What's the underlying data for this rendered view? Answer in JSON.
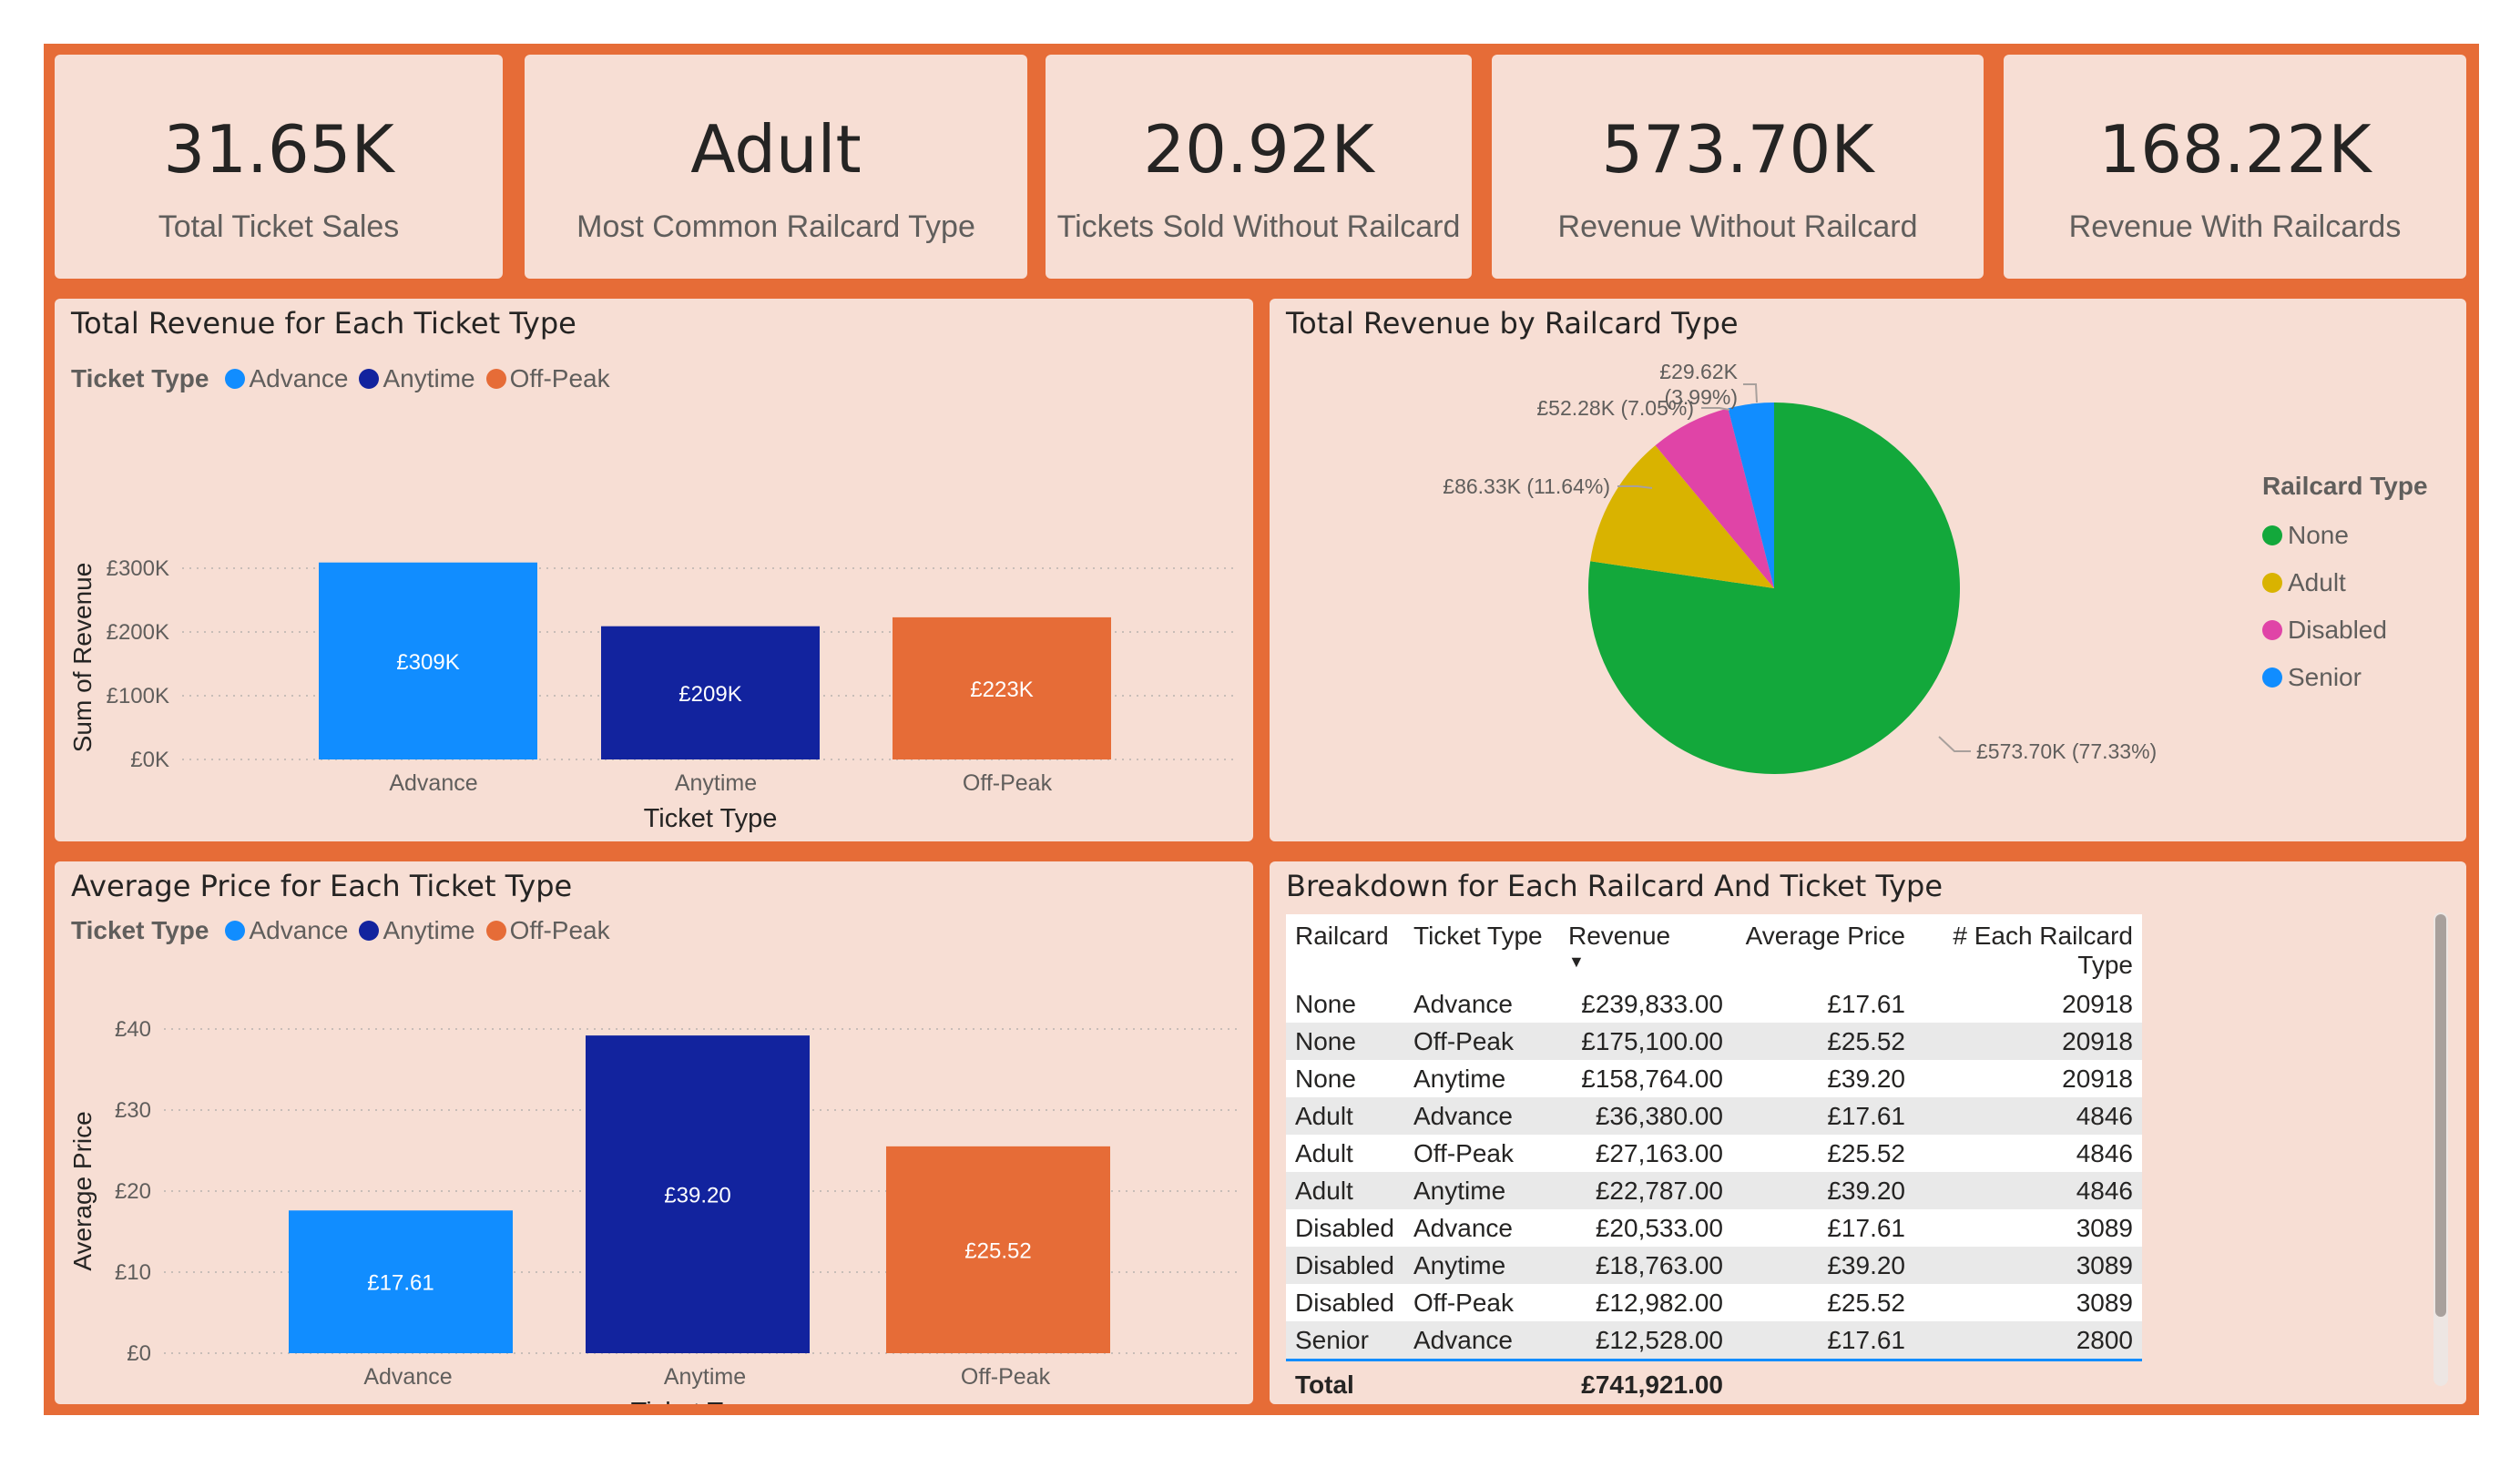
{
  "kpis": [
    {
      "value": "31.65K",
      "label": "Total Ticket Sales"
    },
    {
      "value": "Adult",
      "label": "Most Common Railcard Type"
    },
    {
      "value": "20.92K",
      "label": "Tickets Sold Without Railcard"
    },
    {
      "value": "573.70K",
      "label": "Revenue Without Railcard"
    },
    {
      "value": "168.22K",
      "label": "Revenue With Railcards"
    }
  ],
  "colors": {
    "frame": "#E66C37",
    "panel": "#F7DED4",
    "advance": "#118DFF",
    "anytime": "#12239E",
    "offpeak": "#E66C37",
    "none": "#13A83B",
    "adult": "#D9B300",
    "disabled": "#E044A7",
    "senior": "#118DFF"
  },
  "revenue_chart": {
    "title": "Total Revenue for Each Ticket Type",
    "legend_title": "Ticket Type",
    "legend": [
      "Advance",
      "Anytime",
      "Off-Peak"
    ],
    "chart_data": {
      "type": "bar",
      "categories": [
        "Advance",
        "Anytime",
        "Off-Peak"
      ],
      "values": [
        309,
        209,
        223
      ],
      "data_labels": [
        "£309K",
        "£209K",
        "£223K"
      ],
      "yticks": [
        "£0K",
        "£100K",
        "£200K",
        "£300K"
      ],
      "ylim": [
        0,
        320
      ],
      "xlabel": "Ticket Type",
      "ylabel": "Sum of Revenue",
      "grid": true
    }
  },
  "price_chart": {
    "title": "Average Price for Each Ticket Type",
    "legend_title": "Ticket Type",
    "legend": [
      "Advance",
      "Anytime",
      "Off-Peak"
    ],
    "chart_data": {
      "type": "bar",
      "categories": [
        "Advance",
        "Anytime",
        "Off-Peak"
      ],
      "values": [
        17.61,
        39.2,
        25.52
      ],
      "data_labels": [
        "£17.61",
        "£39.20",
        "£25.52"
      ],
      "yticks": [
        "£0",
        "£10",
        "£20",
        "£30",
        "£40"
      ],
      "ylim": [
        0,
        40
      ],
      "xlabel": "Ticket Type",
      "ylabel": "Average Price",
      "grid": true
    }
  },
  "pie_chart": {
    "title": "Total Revenue by Railcard Type",
    "legend_title": "Railcard Type",
    "legend": [
      "None",
      "Adult",
      "Disabled",
      "Senior"
    ],
    "chart_data": {
      "type": "pie",
      "categories": [
        "None",
        "Adult",
        "Disabled",
        "Senior"
      ],
      "values": [
        573.7,
        86.33,
        52.28,
        29.62
      ],
      "percents": [
        77.33,
        11.64,
        7.05,
        3.99
      ],
      "data_labels": [
        "£573.70K (77.33%)",
        "£86.33K (11.64%)",
        "£52.28K (7.05%)",
        "£29.62K",
        "(3.99%)"
      ]
    }
  },
  "table": {
    "title": "Breakdown for Each Railcard And Ticket Type",
    "columns": [
      "Railcard",
      "Ticket Type",
      "Revenue",
      "Average Price",
      "# Each Railcard Type"
    ],
    "rows": [
      [
        "None",
        "Advance",
        "£239,833.00",
        "£17.61",
        "20918"
      ],
      [
        "None",
        "Off-Peak",
        "£175,100.00",
        "£25.52",
        "20918"
      ],
      [
        "None",
        "Anytime",
        "£158,764.00",
        "£39.20",
        "20918"
      ],
      [
        "Adult",
        "Advance",
        "£36,380.00",
        "£17.61",
        "4846"
      ],
      [
        "Adult",
        "Off-Peak",
        "£27,163.00",
        "£25.52",
        "4846"
      ],
      [
        "Adult",
        "Anytime",
        "£22,787.00",
        "£39.20",
        "4846"
      ],
      [
        "Disabled",
        "Advance",
        "£20,533.00",
        "£17.61",
        "3089"
      ],
      [
        "Disabled",
        "Anytime",
        "£18,763.00",
        "£39.20",
        "3089"
      ],
      [
        "Disabled",
        "Off-Peak",
        "£12,982.00",
        "£25.52",
        "3089"
      ],
      [
        "Senior",
        "Advance",
        "£12,528.00",
        "£17.61",
        "2800"
      ]
    ],
    "total_label": "Total",
    "total_revenue": "£741,921.00"
  }
}
